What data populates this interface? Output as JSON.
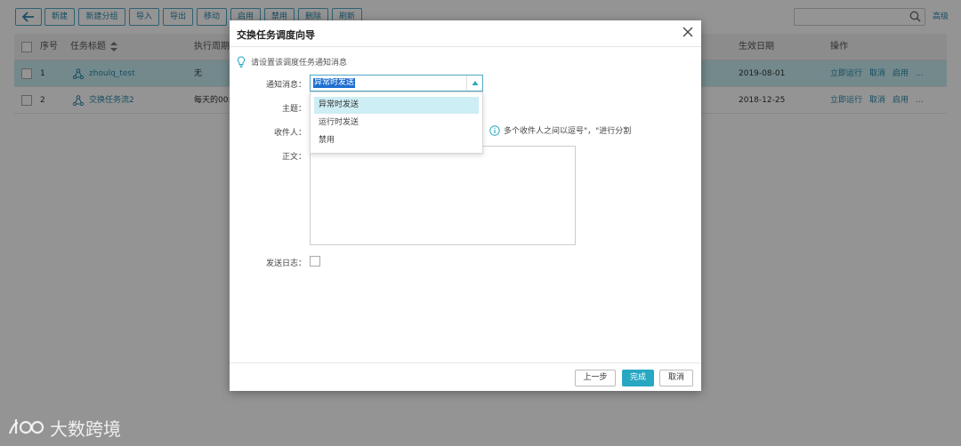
{
  "toolbar": {
    "back_icon": "arrow-left-icon",
    "buttons": [
      "新建",
      "新建分组",
      "导入",
      "导出",
      "移动",
      "启用",
      "禁用",
      "删除",
      "刷新"
    ],
    "search_placeholder": "",
    "advanced_label": "高级"
  },
  "table": {
    "headers": {
      "index": "序号",
      "title": "任务标题",
      "sort_icon": "sort-icon",
      "schedule": "执行周期",
      "effective_date": "生效日期",
      "actions": "操作"
    },
    "rows": [
      {
        "index": "1",
        "title": "zhoulq_test",
        "schedule": "无",
        "effective_date": "2019-08-01",
        "actions": [
          "立即运行",
          "取消",
          "启用",
          "..."
        ],
        "selected": true
      },
      {
        "index": "2",
        "title": "交换任务流2",
        "schedule": "每天的00:",
        "effective_date": "2018-12-25",
        "actions": [
          "立即运行",
          "取消",
          "启用",
          "..."
        ],
        "selected": false
      }
    ]
  },
  "dialog": {
    "title": "交换任务调度向导",
    "close_icon": "close-icon",
    "hint": "请设置该调度任务通知消息",
    "hint_icon": "lightbulb-icon",
    "notify_label": "通知消息：",
    "notify_value": "异常时发送",
    "notify_options": [
      "异常时发送",
      "运行时发送",
      "禁用"
    ],
    "subject_label": "主题：",
    "recipients_label": "收件人：",
    "recipients_hint": "多个收件人之间以逗号\"，\"进行分割",
    "recipients_hint_icon": "info-icon",
    "body_label": "正文：",
    "send_log_label": "发送日志：",
    "send_log_checked": false,
    "prev_label": "上一步",
    "finish_label": "完成",
    "cancel_label": "取消"
  },
  "watermark": {
    "text": "大数跨境",
    "logo": "brand-logo"
  },
  "colors": {
    "accent": "#27a7c1",
    "link": "#2b87a8",
    "row_selected": "#c7ecf2",
    "dropdown_active": "#cdeef4",
    "text_selection": "#1d6fd1"
  }
}
